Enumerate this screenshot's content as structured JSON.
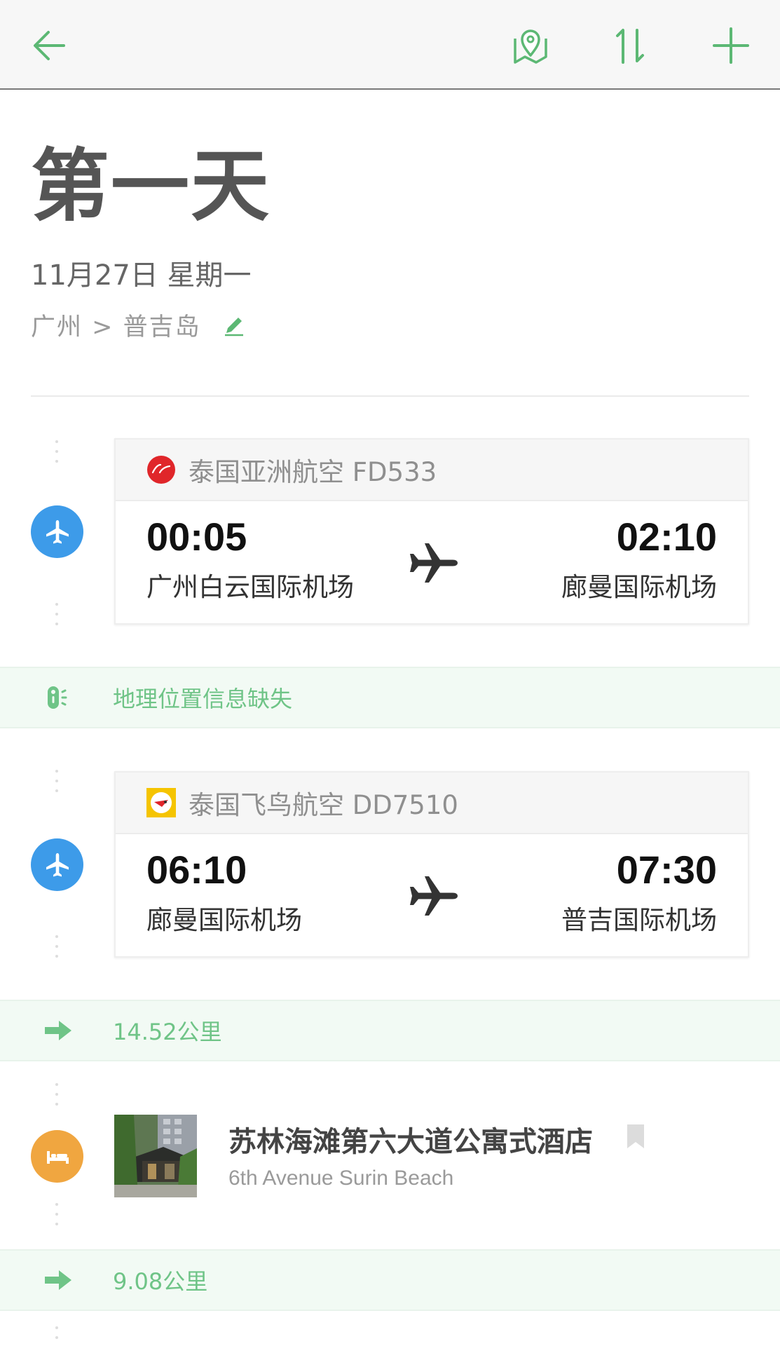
{
  "topbar": {
    "back_icon": "arrow-left-icon",
    "map_icon": "map-pin-icon",
    "sort_icon": "sort-icon",
    "add_icon": "plus-icon",
    "accent_color": "#5cb874"
  },
  "header": {
    "title": "第一天",
    "date": "11月27日  星期一",
    "route": "广州 > 普吉岛"
  },
  "items": [
    {
      "type": "flight",
      "airline": "泰国亚洲航空 FD533",
      "dep_time": "00:05",
      "dep_airport": "广州白云国际机场",
      "arr_time": "02:10",
      "arr_airport": "廊曼国际机场"
    },
    {
      "type": "notice",
      "text": "地理位置信息缺失"
    },
    {
      "type": "flight",
      "airline": "泰国飞鸟航空 DD7510",
      "dep_time": "06:10",
      "dep_airport": "廊曼国际机场",
      "arr_time": "07:30",
      "arr_airport": "普吉国际机场"
    },
    {
      "type": "distance",
      "text": "14.52公里"
    },
    {
      "type": "hotel",
      "name": "苏林海滩第六大道公寓式酒店",
      "subtitle": "6th Avenue Surin Beach"
    },
    {
      "type": "distance",
      "text": "9.08公里"
    }
  ]
}
